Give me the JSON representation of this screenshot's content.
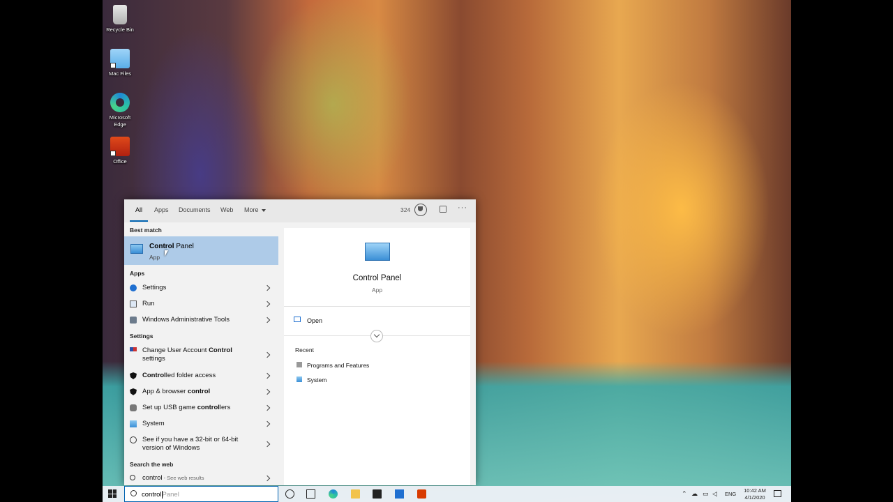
{
  "desktop": {
    "icons": [
      {
        "label": "Recycle Bin",
        "icon": "recycle-bin-icon"
      },
      {
        "label": "Mac Files",
        "icon": "folder-icon"
      },
      {
        "label": "Microsoft Edge",
        "icon": "edge-icon"
      },
      {
        "label": "Office",
        "icon": "office-icon"
      }
    ]
  },
  "search": {
    "tabs": [
      "All",
      "Apps",
      "Documents",
      "Web",
      "More"
    ],
    "points": "324",
    "best_match_header": "Best match",
    "best_match": {
      "title_bold": "Control",
      "title_rest": " Panel",
      "type": "App"
    },
    "apps_header": "Apps",
    "apps": [
      "Settings",
      "Run",
      "Windows Administrative Tools"
    ],
    "settings_header": "Settings",
    "settings": [
      {
        "pre": "Change User Account ",
        "bold": "Control",
        "post": " settings"
      },
      {
        "pre": "",
        "bold": "Control",
        "post": "led folder access"
      },
      {
        "pre": "App & browser ",
        "bold": "control",
        "post": ""
      },
      {
        "pre": "Set up USB game ",
        "bold": "control",
        "post": "lers"
      },
      {
        "pre": "System",
        "bold": "",
        "post": ""
      },
      {
        "pre": "See if you have a 32-bit or 64-bit version of Windows",
        "bold": "",
        "post": ""
      }
    ],
    "web_header": "Search the web",
    "web": {
      "query": "control",
      "hint": " - See web results"
    },
    "preview": {
      "title": "Control Panel",
      "type": "App",
      "open_label": "Open",
      "recent_header": "Recent",
      "recent": [
        "Programs and Features",
        "System"
      ]
    },
    "box": {
      "typed": "control",
      "hint": "Panel"
    }
  },
  "taskbar": {
    "lang": "ENG",
    "time": "10:42 AM",
    "date": "4/1/2020"
  }
}
